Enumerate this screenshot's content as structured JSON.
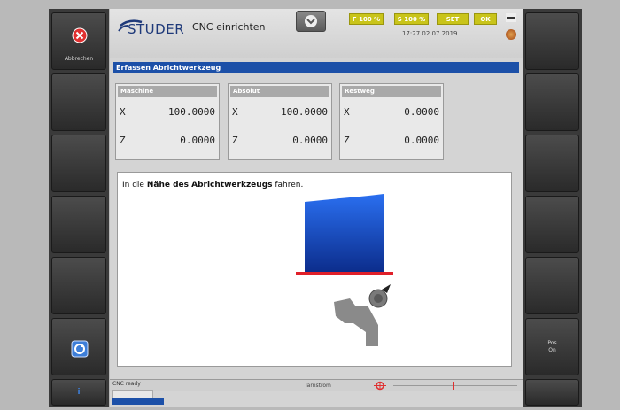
{
  "left_panel": {
    "close_label": "Abbrechen",
    "info_label": "i"
  },
  "right_panel": {
    "posit_label_line1": "Pos",
    "posit_label_line2": "On"
  },
  "header": {
    "brand": "STUDER",
    "title": "CNC einrichten",
    "datetime": "17:27 02.07.2019"
  },
  "status": {
    "feed": "F 100 %",
    "spindle": "S 100 %",
    "set": "SET",
    "ok": "OK"
  },
  "section": {
    "title": "Erfassen Abrichtwerkzeug"
  },
  "coords": [
    {
      "name": "Maschine",
      "x": "100.0000",
      "z": "0.0000"
    },
    {
      "name": "Absolut",
      "x": "100.0000",
      "z": "0.0000"
    },
    {
      "name": "Restweg",
      "x": "0.0000",
      "z": "0.0000"
    }
  ],
  "axes": {
    "x": "X",
    "z": "Z"
  },
  "instruction": {
    "prefix": "In die ",
    "bold": "Nähe des Abrichtwerkzeugs",
    "suffix": " fahren."
  },
  "bottom": {
    "cnc_ready": "CNC ready",
    "speed_label": "Tarnstrom"
  },
  "colors": {
    "header_blue": "#1c50a8",
    "status_yellow": "#c9c41a",
    "workpiece_blue": "#1a5fd0",
    "base_red": "#e0202a"
  }
}
